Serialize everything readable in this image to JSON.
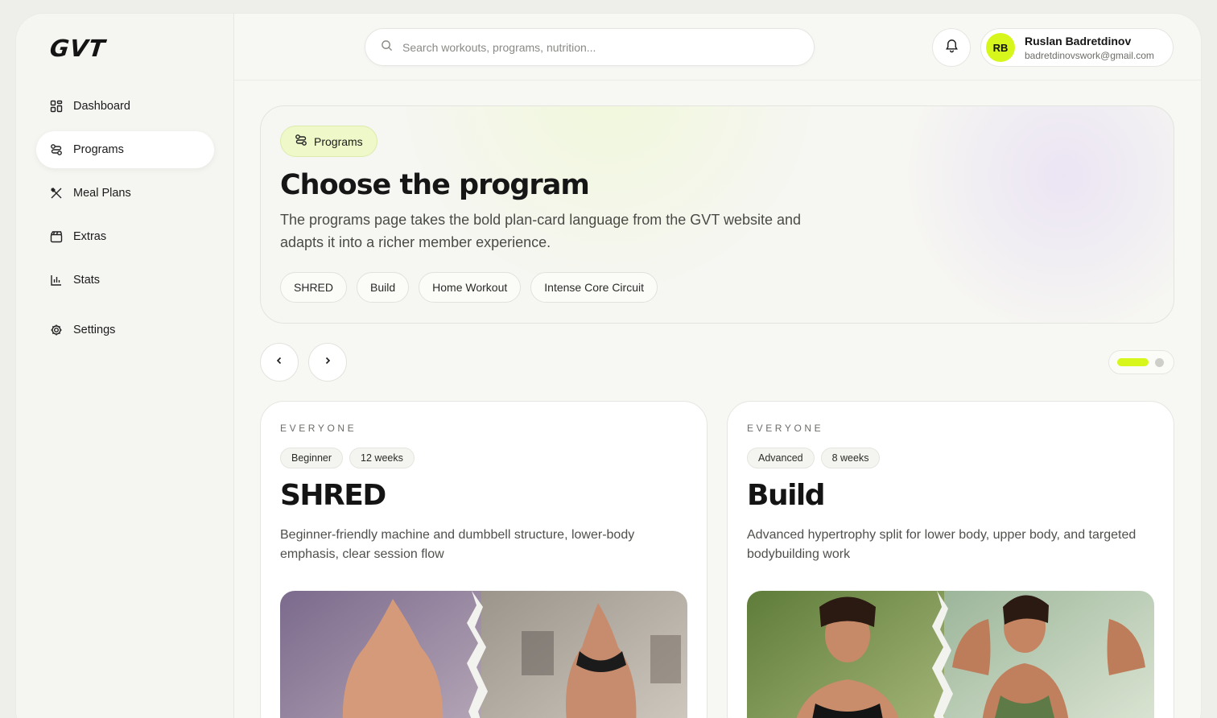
{
  "brand": {
    "logo": "GVT",
    "accent": "#d7f71c"
  },
  "sidebar": {
    "items": [
      {
        "label": "Dashboard",
        "icon": "grid-icon"
      },
      {
        "label": "Programs",
        "icon": "programs-icon",
        "active": true
      },
      {
        "label": "Meal Plans",
        "icon": "utensils-icon"
      },
      {
        "label": "Extras",
        "icon": "clapperboard-icon"
      },
      {
        "label": "Stats",
        "icon": "bar-chart-icon"
      },
      {
        "label": "Settings",
        "icon": "gear-icon"
      }
    ]
  },
  "topbar": {
    "search": {
      "placeholder": "Search workouts, programs, nutrition..."
    },
    "user": {
      "initials": "RB",
      "name": "Ruslan Badretdinov",
      "email": "badretdinovswork@gmail.com"
    }
  },
  "hero": {
    "badge": "Programs",
    "title": "Choose the program",
    "description": "The programs page takes the bold plan-card language from the GVT website and adapts it into a richer member experience.",
    "chips": [
      "SHRED",
      "Build",
      "Home Workout",
      "Intense Core Circuit"
    ]
  },
  "carousel": {
    "pages": 2,
    "active_page": 1
  },
  "programs": [
    {
      "audience": "EVERYONE",
      "level": "Beginner",
      "duration": "12 weeks",
      "title": "SHRED",
      "description": "Beginner-friendly machine and dumbbell structure, lower-body emphasis, clear session flow"
    },
    {
      "audience": "EVERYONE",
      "level": "Advanced",
      "duration": "8 weeks",
      "title": "Build",
      "description": "Advanced hypertrophy split for lower body, upper body, and targeted bodybuilding work"
    }
  ]
}
